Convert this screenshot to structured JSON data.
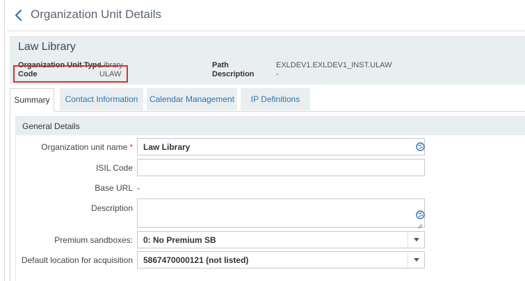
{
  "header": {
    "title": "Organization Unit Details",
    "unit_name": "Law Library",
    "fields": {
      "type_label": "Organization Unit Type",
      "type_value": "Library",
      "code_label": "Code",
      "code_value": "ULAW",
      "path_label": "Path",
      "path_value": "EXLDEV1.EXLDEV1_INST.ULAW",
      "description_label": "Description",
      "description_value": "-"
    }
  },
  "tabs": [
    {
      "label": "Summary",
      "active": true
    },
    {
      "label": "Contact Information",
      "active": false
    },
    {
      "label": "Calendar Management",
      "active": false
    },
    {
      "label": "IP Definitions",
      "active": false
    }
  ],
  "section": {
    "title": "General Details"
  },
  "form": {
    "name_label": "Organization unit name",
    "required_mark": "*",
    "name_value": "Law Library",
    "isil_label": "ISIL Code",
    "isil_value": "",
    "base_url_label": "Base URL",
    "base_url_value": "-",
    "description_label": "Description",
    "description_value": "",
    "sandbox_label": "Premium sandboxes:",
    "sandbox_value": "0: No Premium SB",
    "acq_location_label": "Default location for acquisition",
    "acq_location_value": "5867470000121 (not listed)"
  },
  "colors": {
    "highlight": "#d9322b",
    "link": "#2a74b5",
    "panel": "#e9eef0",
    "globe": "#2a74b5"
  },
  "icons": {
    "back": "chevron-left-icon",
    "globe": "globe-icon",
    "dropdown": "caret-down-icon"
  }
}
